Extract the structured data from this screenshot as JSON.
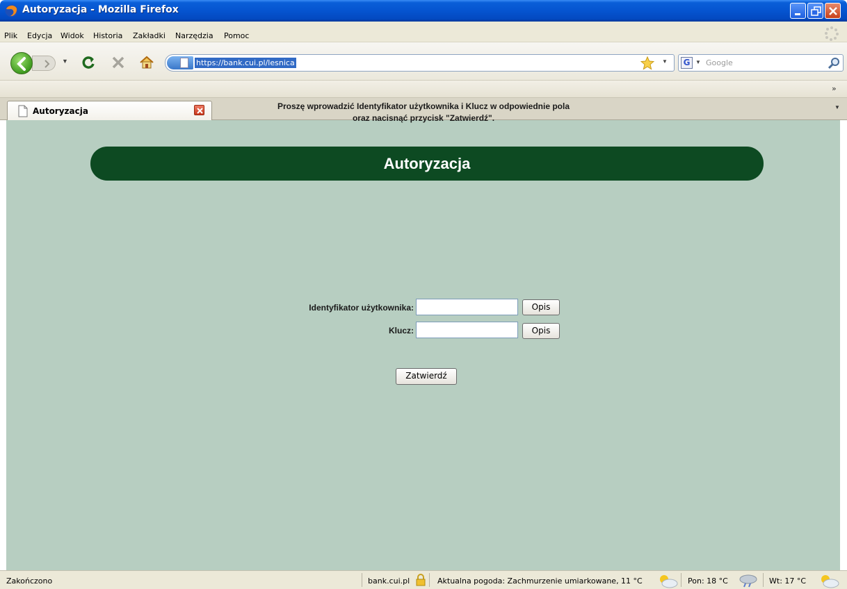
{
  "window": {
    "title": "Autoryzacja - Mozilla Firefox"
  },
  "menu": {
    "items": [
      "Plik",
      "Edycja",
      "Widok",
      "Historia",
      "Zakładki",
      "Narzędzia",
      "Pomoc"
    ]
  },
  "navigation": {
    "url": "https://bank.cui.pl/lesnica",
    "search_placeholder": "Google",
    "bookmarks_more": "»"
  },
  "tabs": [
    {
      "label": "Autoryzacja"
    }
  ],
  "page": {
    "banner_title": "Autoryzacja",
    "instruction_line1": "Proszę wprowadzić Identyfikator użytkownika i Klucz w odpowiednie pola",
    "instruction_line2": "oraz nacisnąć przycisk \"Zatwierdź\".",
    "user_id_label": "Identyfikator użytkownika:",
    "user_id_value": "",
    "key_label": "Klucz:",
    "key_value": "",
    "opis_label": "Opis",
    "submit_label": "Zatwierdź",
    "background_color": "#b7cec1",
    "banner_color": "#0d4a22"
  },
  "status": {
    "text": "Zakończono",
    "domain": "bank.cui.pl",
    "weather_today": "Aktualna pogoda: Zachmurzenie umiarkowane, 11 °C",
    "weather_mon": "Pon: 18 °C",
    "weather_tue": "Wt: 17 °C"
  },
  "icons": {
    "app": "firefox-icon",
    "window_controls": [
      "minimize-icon",
      "maximize-icon",
      "close-icon"
    ],
    "nav": [
      "back-icon",
      "forward-icon",
      "reload-icon",
      "stop-icon",
      "home-icon",
      "bookmark-star-icon",
      "search-icon"
    ],
    "status": [
      "lock-icon",
      "partly-cloudy-icon",
      "rain-icon"
    ]
  }
}
